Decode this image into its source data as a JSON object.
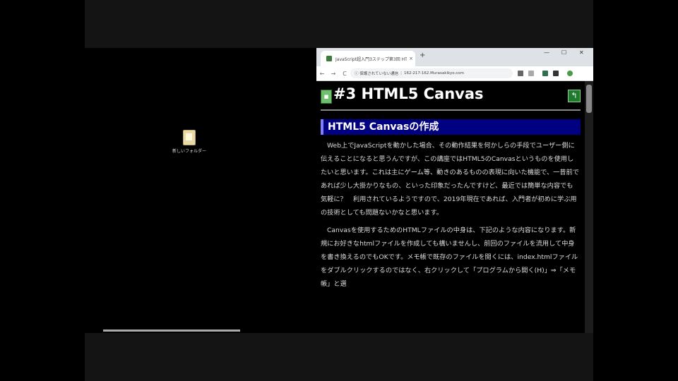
{
  "desktop": {
    "icon_label": "新しいフォルダー"
  },
  "browser": {
    "tab_title": "JavaScript超入門3ステップ第3回 HTML5",
    "tab_close": "×",
    "new_tab": "+",
    "win_min": "—",
    "win_max": "☐",
    "win_close": "✕",
    "nav_back": "←",
    "nav_forward": "→",
    "nav_reload": "C",
    "address_security": "保護されていない通信",
    "address_url": "162-217-162.Murasakikyo.com",
    "icons": [
      "search-icon",
      "star-icon",
      "extension-icon",
      "profile-icon",
      "menu-icon"
    ]
  },
  "page": {
    "title": "#3 HTML5 Canvas",
    "section_heading": "HTML5 Canvasの作成",
    "paragraph1": "Web上でJavaScriptを動かした場合、その動作結果を何かしらの手段でユーザー側に伝えることになると思うんですが、この講座ではHTML5のCanvasというものを使用したいと思います。これは主にゲーム等、動きのあるものの表現に向いた機能で、一昔前であれば少し大掛かりなもの、といった印象だったんですけど、最近では簡単な内容でも気軽に？　利用されているようですので、2019年現在であれば、入門者が初めに学ぶ用の技術としても問題ないかなと思います。",
    "paragraph2": "Canvasを使用するためのHTMLファイルの中身は、下記のような内容になります。新規にお好きなhtmlファイルを作成しても構いませんし、前回のファイルを流用して中身を書き換えるのでもOKです。メモ帳で既存のファイルを開くには、index.htmlファイルをダブルクリックするのではなく、右クリックして「プログラムから開く(H)」⇒「メモ帳」と選"
  },
  "colors": {
    "section_bg": "#000080",
    "section_border": "#8080ff",
    "page_bg": "#000000",
    "text": "#dddddd"
  }
}
